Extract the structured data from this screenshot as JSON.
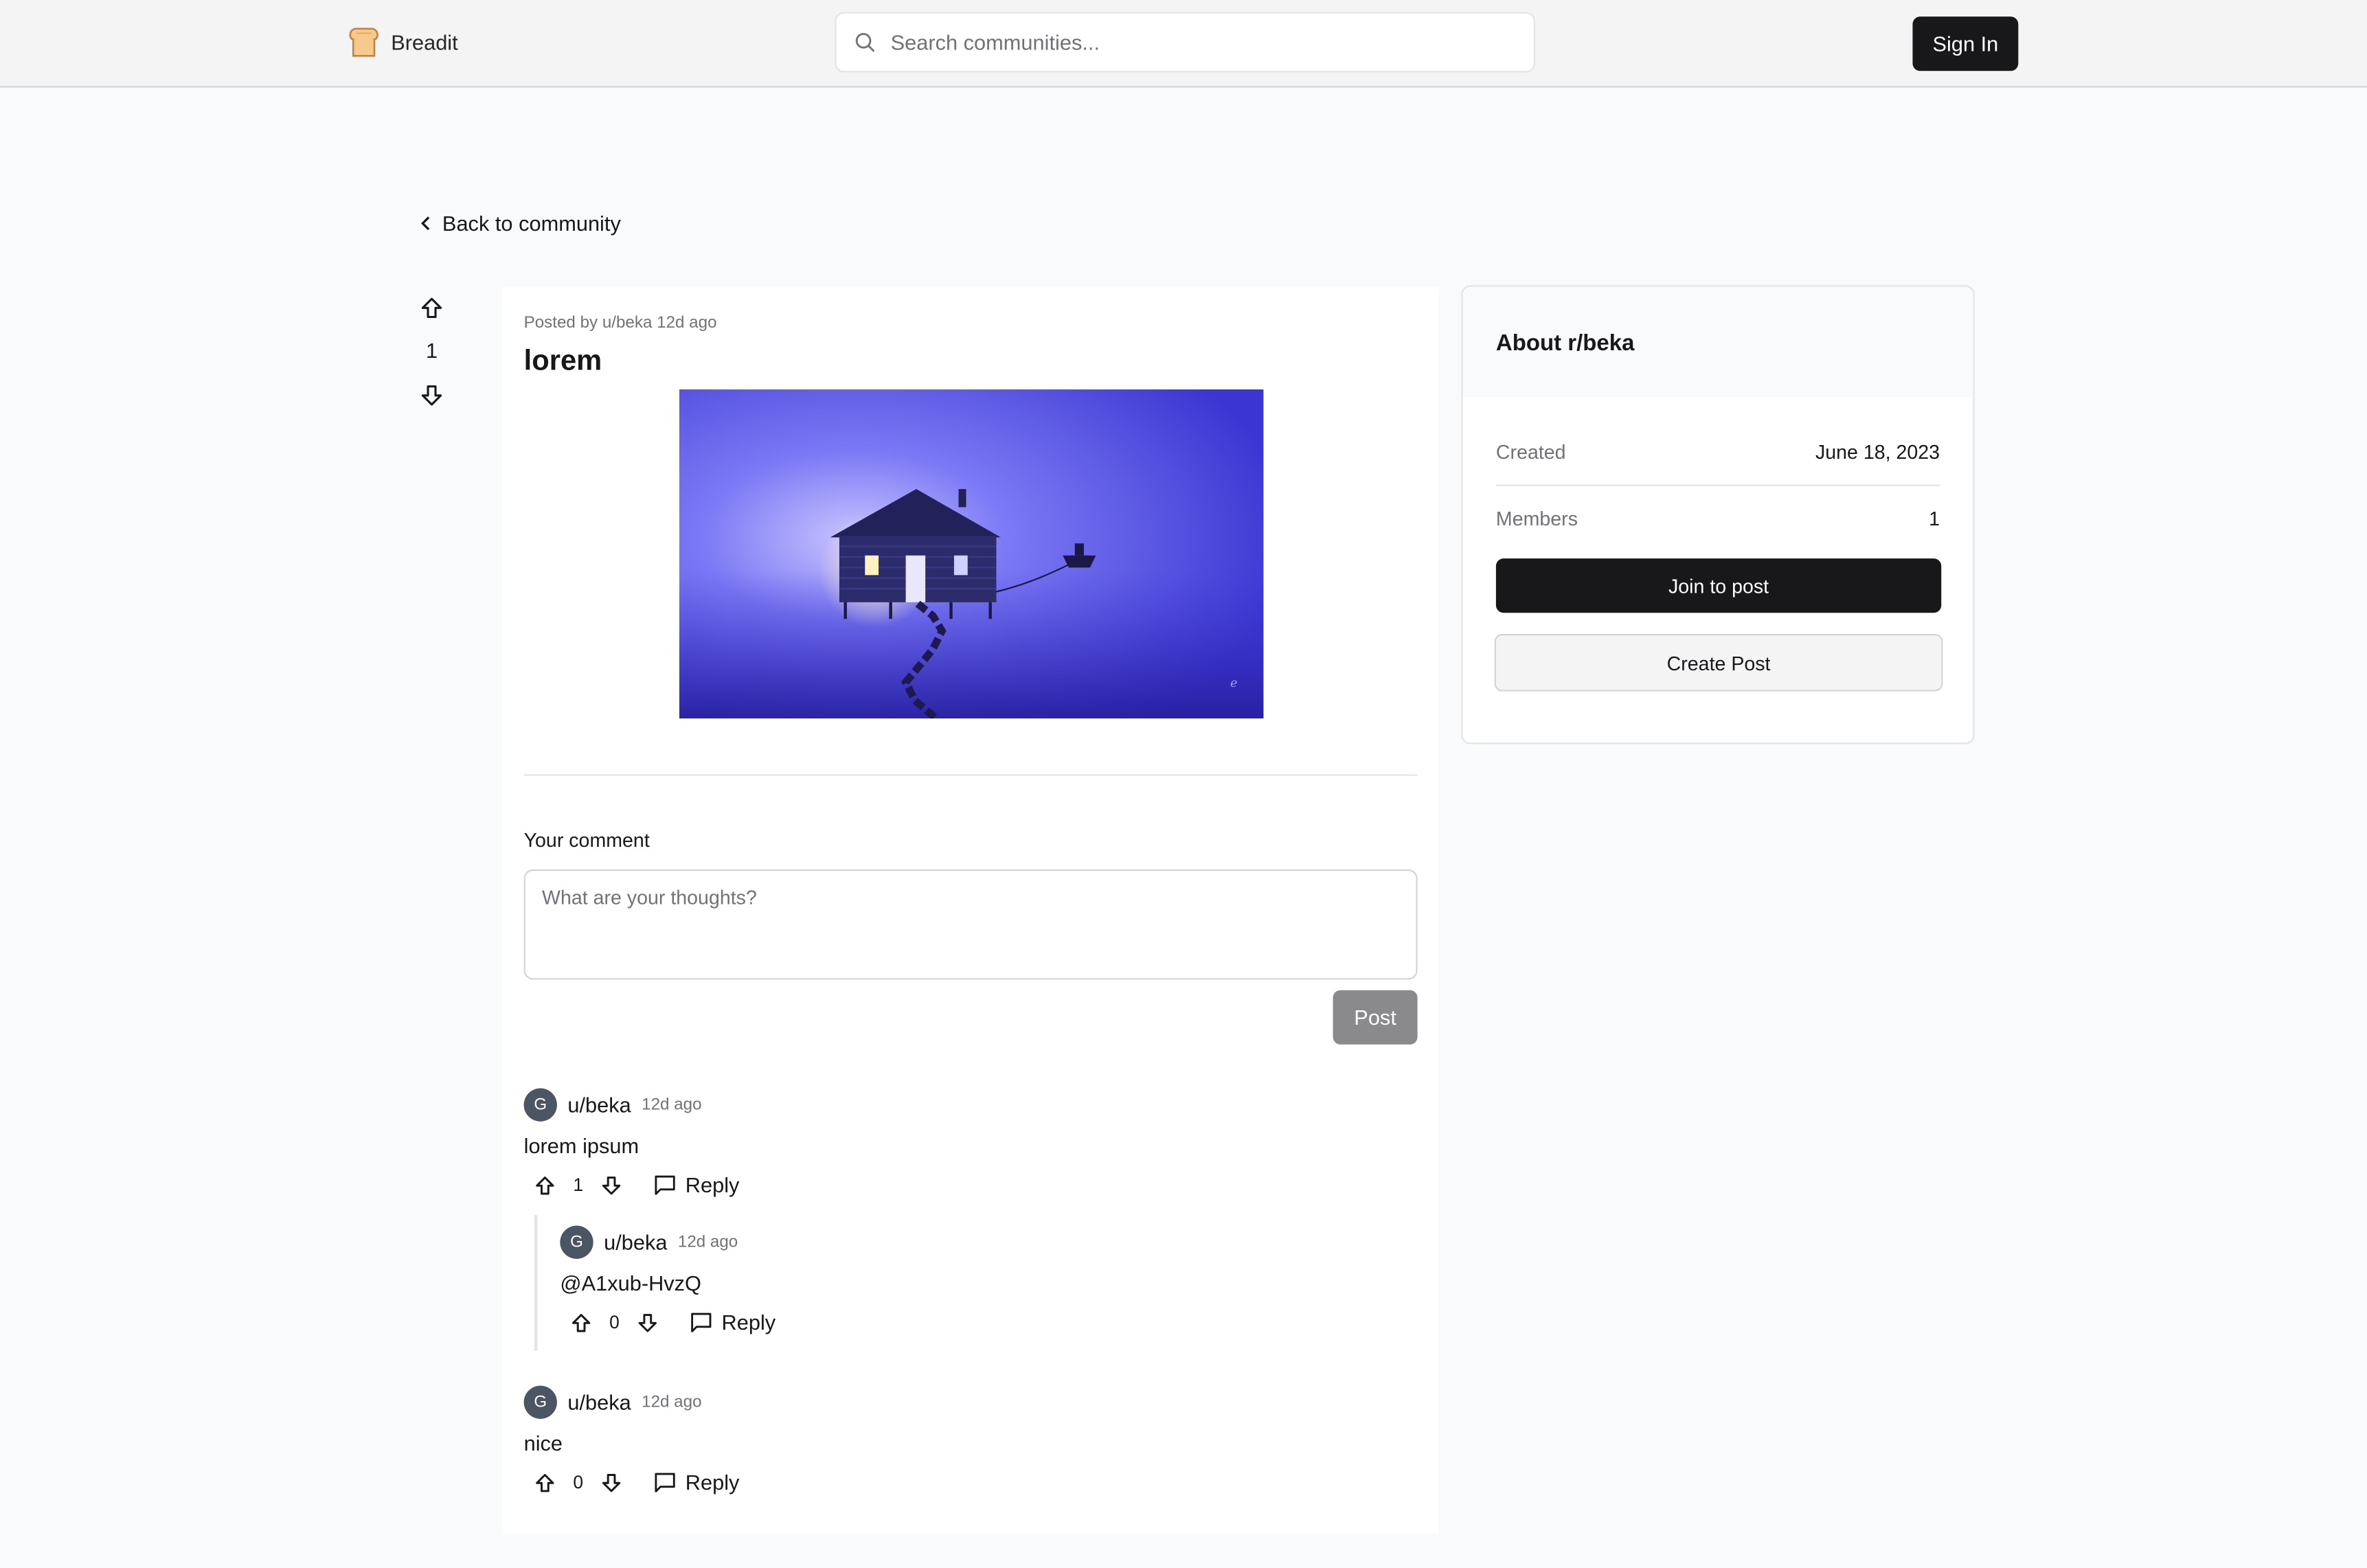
{
  "header": {
    "logo_text": "Breadit",
    "search_placeholder": "Search communities...",
    "signin_label": "Sign In"
  },
  "back_label": "Back to community",
  "post": {
    "votes": "1",
    "meta": "Posted by u/beka 12d ago",
    "title": "lorem",
    "comment_label": "Your comment",
    "comment_placeholder": "What are your thoughts?",
    "post_button": "Post"
  },
  "comments": [
    {
      "avatar": "G",
      "user": "u/beka",
      "time": "12d ago",
      "text": "lorem ipsum",
      "votes": "1",
      "reply": "Reply"
    },
    {
      "avatar": "G",
      "user": "u/beka",
      "time": "12d ago",
      "text": "@A1xub-HvzQ",
      "votes": "0",
      "reply": "Reply"
    },
    {
      "avatar": "G",
      "user": "u/beka",
      "time": "12d ago",
      "text": "nice",
      "votes": "0",
      "reply": "Reply"
    }
  ],
  "sidebar": {
    "title": "About r/beka",
    "created_label": "Created",
    "created_value": "June 18, 2023",
    "members_label": "Members",
    "members_value": "1",
    "join_label": "Join to post",
    "create_label": "Create Post"
  },
  "colors": {
    "accent_dark": "#18181b",
    "image_blue": "#6b6cf0",
    "muted_text": "#71717a"
  }
}
